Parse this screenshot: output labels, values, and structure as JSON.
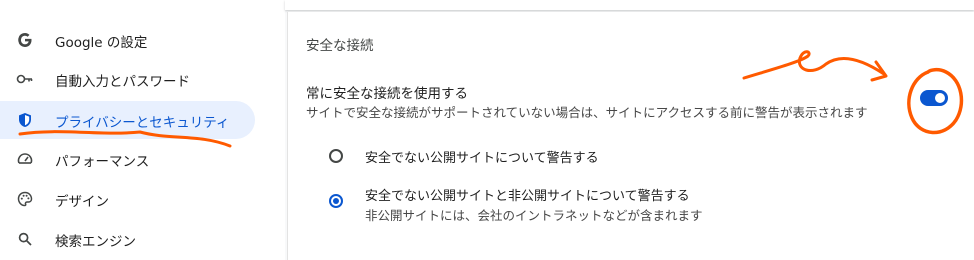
{
  "sidebar": {
    "items": [
      {
        "label": "Google の設定",
        "icon": "google-g-icon"
      },
      {
        "label": "自動入力とパスワード",
        "icon": "key-icon"
      },
      {
        "label": "プライバシーとセキュリティ",
        "icon": "shield-icon"
      },
      {
        "label": "パフォーマンス",
        "icon": "speedometer-icon"
      },
      {
        "label": "デザイン",
        "icon": "palette-icon"
      },
      {
        "label": "検索エンジン",
        "icon": "search-icon"
      }
    ],
    "active_index": 2
  },
  "main": {
    "section_title": "安全な接続",
    "setting": {
      "title": "常に安全な接続を使用する",
      "description": "サイトで安全な接続がサポートされていない場合は、サイトにアクセスする前に警告が表示されます",
      "toggle_on": true
    },
    "options": [
      {
        "label": "安全でない公開サイトについて警告する",
        "selected": false
      },
      {
        "label": "安全でない公開サイトと非公開サイトについて警告する",
        "sublabel": "非公開サイトには、会社のイントラネットなどが含まれます",
        "selected": true
      }
    ]
  },
  "colors": {
    "accent": "#0b57d0",
    "active_nav_bg": "#e8f0fe",
    "annotation": "#ff5a00"
  }
}
